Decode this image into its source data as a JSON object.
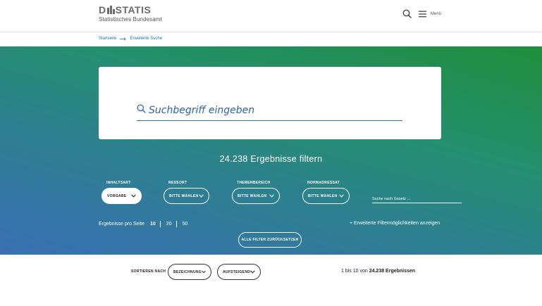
{
  "header": {
    "logo_prefix": "D",
    "logo_suffix": "STATIS",
    "logo_subtitle": "Statistisches Bundesamt",
    "menu_label": "Menü"
  },
  "breadcrumb": {
    "items": [
      "Startseite",
      "Erweiterte Suche"
    ]
  },
  "search": {
    "placeholder": "Suchbegriff eingeben"
  },
  "results_title": "24.238 Ergebnisse filtern",
  "filters": [
    {
      "label": "INHALTSART",
      "value": "VORGABE"
    },
    {
      "label": "RESSORT",
      "value": "BITTE WÄHLEN"
    },
    {
      "label": "THEMENBEREICH",
      "value": "BITTE WÄHLEN"
    },
    {
      "label": "NORMADRESSAT",
      "value": "BITTE WÄHLEN"
    }
  ],
  "law_search": {
    "placeholder": "Suche nach Gesetz ..."
  },
  "per_page": {
    "label": "Ergebnisse pro Seite",
    "options": [
      "10",
      "20",
      "50"
    ],
    "selected": "10"
  },
  "extended_filters": "+ Erweiterte Filtermöglichkeiten anzeigen",
  "reset_label": "ALLE FILTER ZURÜCKSETZEN",
  "sort": {
    "label": "SORTIEREN NACH",
    "field": "BEZEICHNUNG",
    "order": "AUFSTEIGEND"
  },
  "result_count": {
    "prefix": "1 bis 10 von",
    "total": "24.238 Ergebnissen"
  },
  "colors": {
    "gradient_blue": "#3a6fb5",
    "gradient_green": "#1f8e3c",
    "link_blue": "#1d6fb8"
  }
}
